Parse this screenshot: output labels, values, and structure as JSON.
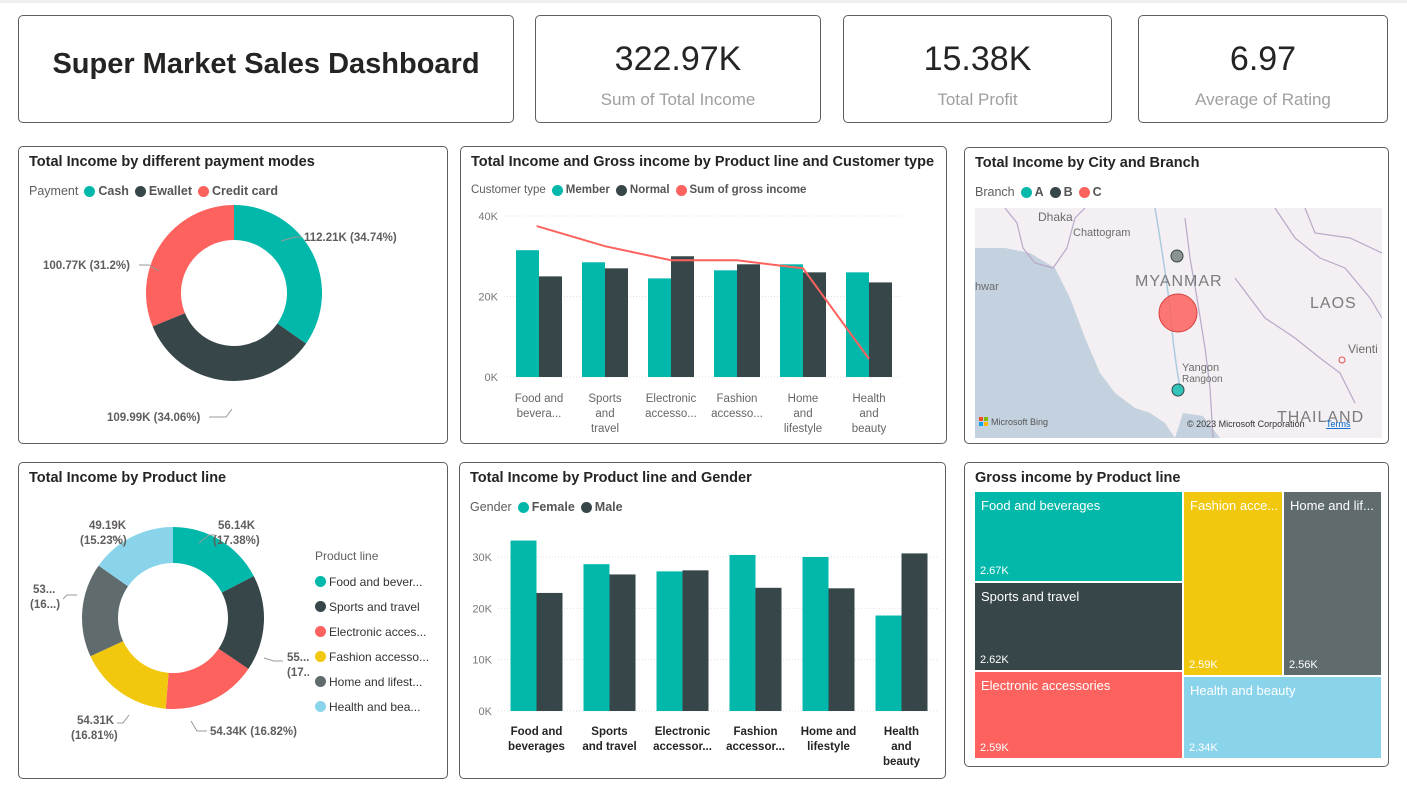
{
  "colors": {
    "teal": "#01b8aa",
    "dark": "#374649",
    "red": "#fd625e",
    "yellow": "#f2c80f",
    "grey": "#5f6b6d",
    "lightblue": "#8ad4eb"
  },
  "dashboard": {
    "title": "Super Market Sales Dashboard"
  },
  "kpis": [
    {
      "value": "322.97K",
      "label": "Sum of Total Income"
    },
    {
      "value": "15.38K",
      "label": "Total Profit"
    },
    {
      "value": "6.97",
      "label": "Average of Rating"
    }
  ],
  "payment": {
    "title": "Total Income by different payment modes",
    "legend_label": "Payment",
    "labels": [
      "112.21K (34.74%)",
      "109.99K (34.06%)",
      "100.77K (31.2%)"
    ]
  },
  "product_customer": {
    "title": "Total Income and Gross income by Product line and Customer type",
    "legend_label": "Customer type",
    "yticks": [
      "40K",
      "20K",
      "0K"
    ],
    "categories": [
      [
        "Food and",
        "bevera..."
      ],
      [
        "Sports",
        "and",
        "travel"
      ],
      [
        "Electronic",
        "accesso..."
      ],
      [
        "Fashion",
        "accesso..."
      ],
      [
        "Home",
        "and",
        "lifestyle"
      ],
      [
        "Health",
        "and",
        "beauty"
      ]
    ]
  },
  "map": {
    "title": "Total Income by City and Branch",
    "legend_label": "Branch",
    "places": [
      "Dhaka",
      "Chattogram",
      "MYANMAR",
      "LAOS",
      "Yangon",
      "Rangoon",
      "THAILAND",
      "Vienti",
      "hwar"
    ],
    "bing": "Microsoft Bing",
    "copyright": "© 2023 Microsoft Corporation",
    "terms": "Terms"
  },
  "product_line": {
    "title": "Total Income by Product line",
    "legend_label": "Product line",
    "legend": [
      "Food and bever...",
      "Sports and travel",
      "Electronic acces...",
      "Fashion accesso...",
      "Home and lifest...",
      "Health and bea..."
    ],
    "labels": [
      [
        "56.14K",
        "(17.38%)"
      ],
      [
        "55...",
        "(17...)"
      ],
      [
        "54.34K (16.82%)"
      ],
      [
        "54.31K",
        "(16.81%)"
      ],
      [
        "53...",
        "(16...)"
      ],
      [
        "49.19K",
        "(15.23%)"
      ]
    ]
  },
  "product_gender": {
    "title": "Total Income by Product line and Gender",
    "legend_label": "Gender",
    "yticks": [
      "30K",
      "20K",
      "10K",
      "0K"
    ],
    "categories": [
      [
        "Food and",
        "beverages"
      ],
      [
        "Sports",
        "and travel"
      ],
      [
        "Electronic",
        "accessor..."
      ],
      [
        "Fashion",
        "accessor..."
      ],
      [
        "Home and",
        "lifestyle"
      ],
      [
        "Health",
        "and",
        "beauty"
      ]
    ]
  },
  "treemap": {
    "title": "Gross income by Product line",
    "tiles": [
      {
        "name": "Food and beverages",
        "value": "2.67K"
      },
      {
        "name": "Sports and travel",
        "value": "2.62K"
      },
      {
        "name": "Electronic accessories",
        "value": "2.59K"
      },
      {
        "name": "Fashion acce...",
        "value": "2.59K"
      },
      {
        "name": "Home and lif...",
        "value": "2.56K"
      },
      {
        "name": "Health and beauty",
        "value": "2.34K"
      }
    ]
  },
  "chart_data": [
    {
      "type": "pie",
      "title": "Total Income by different payment modes",
      "legend_title": "Payment",
      "categories": [
        "Cash",
        "Ewallet",
        "Credit card"
      ],
      "values": [
        112.21,
        109.99,
        100.77
      ],
      "percent": [
        34.74,
        34.06,
        31.2
      ],
      "unit": "K"
    },
    {
      "type": "bar",
      "title": "Total Income and Gross income by Product line and Customer type",
      "legend_title": "Customer type",
      "categories": [
        "Food and beverages",
        "Sports and travel",
        "Electronic accessories",
        "Fashion accessories",
        "Home and lifestyle",
        "Health and beauty"
      ],
      "series": [
        {
          "name": "Member",
          "values": [
            31.5,
            28.5,
            24.5,
            26.5,
            28.0,
            26.0
          ]
        },
        {
          "name": "Normal",
          "values": [
            25.0,
            27.0,
            30.0,
            28.0,
            26.0,
            23.5
          ]
        },
        {
          "name": "Sum of gross income",
          "type": "line",
          "values": [
            37.5,
            32.5,
            29.0,
            29.0,
            27.0,
            4.5
          ]
        }
      ],
      "ylim": [
        0,
        42
      ]
    },
    {
      "type": "pie",
      "title": "Total Income by Product line",
      "legend_title": "Product line",
      "categories": [
        "Food and beverages",
        "Sports and travel",
        "Electronic accessories",
        "Fashion accessories",
        "Home and lifestyle",
        "Health and beauty"
      ],
      "values": [
        56.14,
        55.12,
        54.34,
        54.31,
        53.86,
        49.19
      ],
      "percent": [
        17.38,
        17.07,
        16.82,
        16.81,
        16.68,
        15.23
      ],
      "unit": "K"
    },
    {
      "type": "bar",
      "title": "Total Income by Product line and Gender",
      "legend_title": "Gender",
      "categories": [
        "Food and beverages",
        "Sports and travel",
        "Electronic accessories",
        "Fashion accessories",
        "Home and lifestyle",
        "Health and beauty"
      ],
      "series": [
        {
          "name": "Female",
          "values": [
            33.2,
            28.6,
            27.2,
            30.4,
            30.0,
            18.6
          ]
        },
        {
          "name": "Male",
          "values": [
            23.0,
            26.6,
            27.4,
            24.0,
            23.9,
            30.7
          ]
        }
      ],
      "ylim": [
        0,
        34
      ]
    },
    {
      "type": "treemap",
      "title": "Gross income by Product line",
      "categories": [
        "Food and beverages",
        "Sports and travel",
        "Electronic accessories",
        "Fashion accessories",
        "Home and lifestyle",
        "Health and beauty"
      ],
      "values": [
        2.67,
        2.62,
        2.59,
        2.59,
        2.56,
        2.34
      ],
      "unit": "K"
    }
  ]
}
